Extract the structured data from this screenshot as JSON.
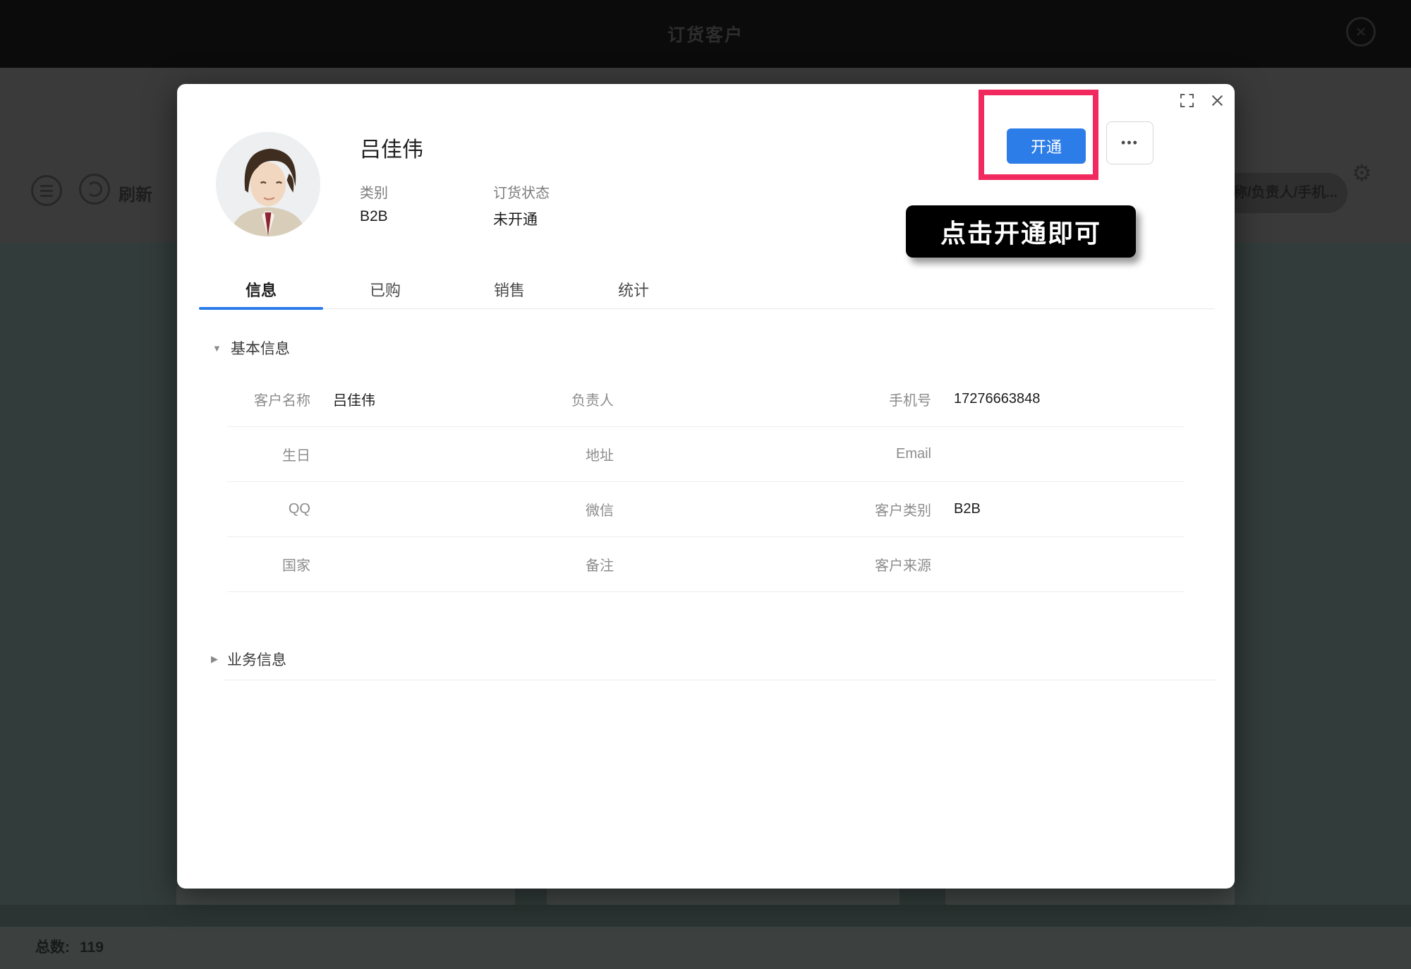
{
  "colors": {
    "accent_blue": "#2d7de9",
    "tab_underline_blue": "#2b7ce9",
    "highlight_pink": "#f1295f",
    "tooltip_bg": "#000000"
  },
  "background": {
    "header_title": "订货客户",
    "toolbar": {
      "refresh_label": "刷新",
      "search_placeholder": "称/负责人/手机..."
    },
    "footer": {
      "total_label": "总数:",
      "total_value": "119"
    }
  },
  "modal": {
    "customer": {
      "name": "吕佳伟",
      "category_label": "类别",
      "category_value": "B2B",
      "order_status_label": "订货状态",
      "order_status_value": "未开通"
    },
    "actions": {
      "activate_label": "开通",
      "more_label": "•••"
    },
    "annotation": {
      "tooltip_text": "点击开通即可"
    },
    "tabs": [
      {
        "label": "信息",
        "active": true
      },
      {
        "label": "已购",
        "active": false
      },
      {
        "label": "销售",
        "active": false
      },
      {
        "label": "统计",
        "active": false
      }
    ],
    "basic_section_title": "基本信息",
    "business_section_title": "业务信息",
    "carets": {
      "expanded": "▼",
      "collapsed": "▶"
    },
    "fields": [
      {
        "label": "客户名称",
        "value": "吕佳伟"
      },
      {
        "label": "负责人",
        "value": ""
      },
      {
        "label": "手机号",
        "value": "17276663848"
      },
      {
        "label": "生日",
        "value": ""
      },
      {
        "label": "地址",
        "value": ""
      },
      {
        "label": "Email",
        "value": ""
      },
      {
        "label": "QQ",
        "value": ""
      },
      {
        "label": "微信",
        "value": ""
      },
      {
        "label": "客户类别",
        "value": "B2B"
      },
      {
        "label": "国家",
        "value": ""
      },
      {
        "label": "备注",
        "value": ""
      },
      {
        "label": "客户来源",
        "value": ""
      }
    ]
  }
}
